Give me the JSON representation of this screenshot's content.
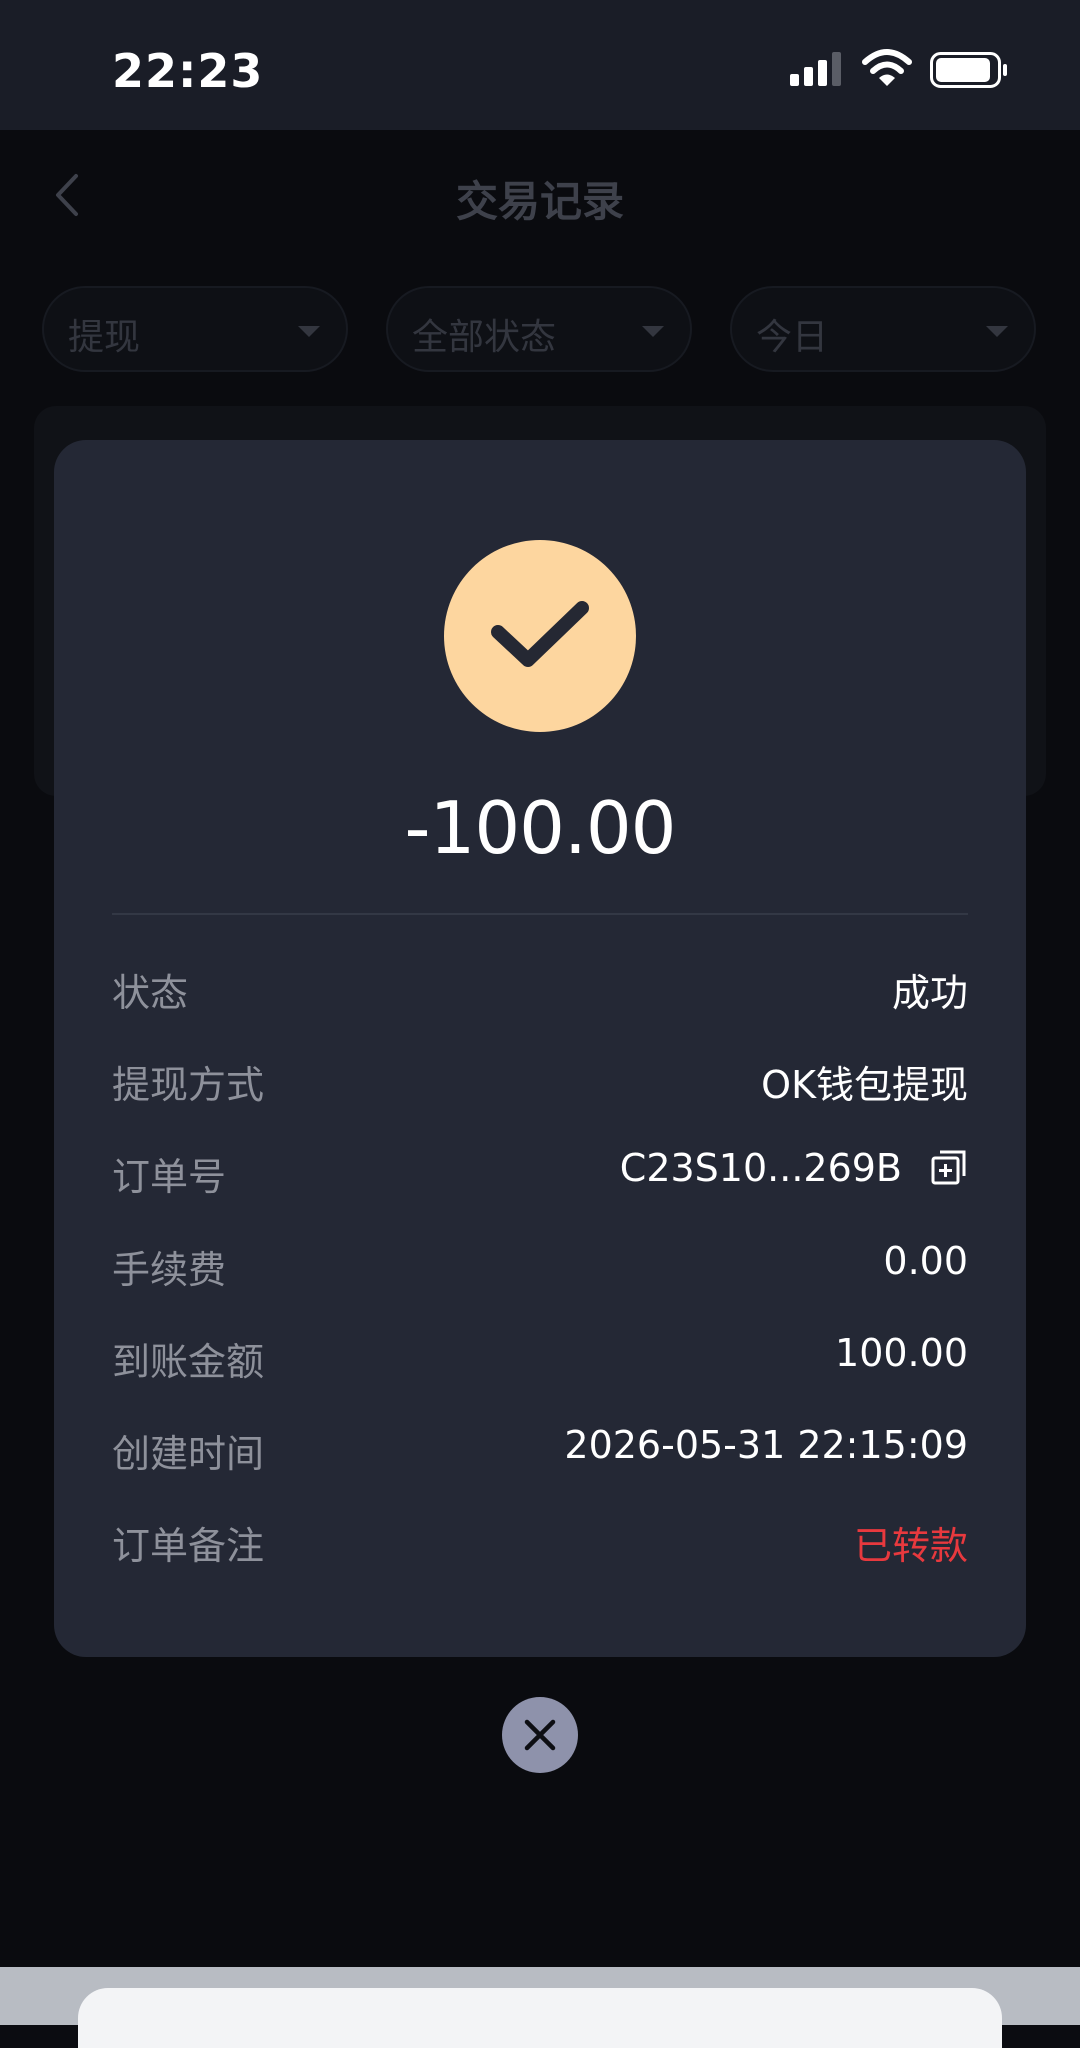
{
  "status_bar": {
    "time": "22:23"
  },
  "header": {
    "title": "交易记录"
  },
  "filters": [
    {
      "label": "提现"
    },
    {
      "label": "全部状态"
    },
    {
      "label": "今日"
    }
  ],
  "modal": {
    "amount": "-100.00",
    "rows": [
      {
        "label": "状态",
        "value": "成功"
      },
      {
        "label": "提现方式",
        "value": "OK钱包提现"
      },
      {
        "label": "订单号",
        "value": "C23S10...269B"
      },
      {
        "label": "手续费",
        "value": "0.00"
      },
      {
        "label": "到账金额",
        "value": "100.00"
      },
      {
        "label": "创建时间",
        "value": "2026-05-31 22:15:09"
      },
      {
        "label": "订单备注",
        "value": "已转款"
      }
    ]
  },
  "colors": {
    "success_badge": "#fdd69f",
    "remark_value": "#e8393e",
    "modal_bg": "#242835"
  },
  "icons": [
    "signal-icon",
    "wifi-icon",
    "battery-icon",
    "back-icon",
    "check-icon",
    "copy-icon",
    "close-icon"
  ]
}
